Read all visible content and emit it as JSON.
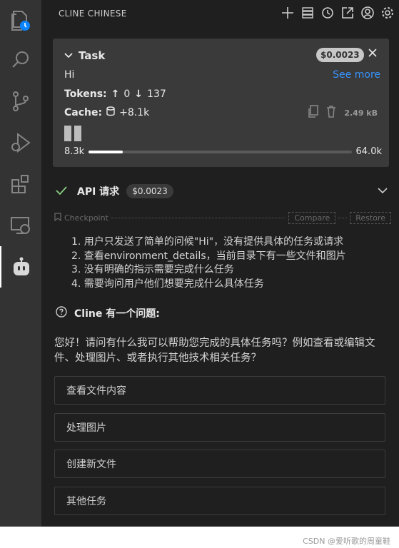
{
  "header": {
    "title": "CLINE CHINESE"
  },
  "activity": {
    "items": [
      "explorer-icon",
      "search-icon",
      "source-control-icon",
      "run-debug-icon",
      "extensions-icon",
      "remote-explorer-icon",
      "cline-icon"
    ],
    "active_index": 6
  },
  "task": {
    "label": "Task",
    "cost": "$0.0023",
    "text": "Hi",
    "see_more": "See more",
    "tokens_label": "Tokens:",
    "tokens_up": "0",
    "tokens_down": "137",
    "cache_label": "Cache:",
    "cache_value": "+8.1k",
    "size": "2.49 kB",
    "context_used": "8.3k",
    "context_max": "64.0k",
    "context_fraction": 0.13
  },
  "api": {
    "title": "API 请求",
    "cost": "$0.0023"
  },
  "checkpoint": {
    "label": "Checkpoint",
    "compare": "Compare",
    "restore": "Restore"
  },
  "steps": [
    "1. 用户只发送了简单的问候\"Hi\"，没有提供具体的任务或请求",
    "2. 查看environment_details，当前目录下有一些文件和图片",
    "3. 没有明确的指示需要完成什么任务",
    "4. 需要询问用户他们想要完成什么具体任务"
  ],
  "question": {
    "title": "Cline 有一个问题:"
  },
  "message": "您好！请问有什么我可以帮助您完成的具体任务吗？例如查看或编辑文件、处理图片、或者执行其他技术相关任务？",
  "options": [
    "查看文件内容",
    "处理图片",
    "创建新文件",
    "其他任务"
  ],
  "watermark": "CSDN @爱听歌的周童鞋",
  "colors": {
    "accent": "#3794ff",
    "check": "#89d185",
    "panel": "#1f1f1f",
    "card": "#3a3a3a"
  }
}
